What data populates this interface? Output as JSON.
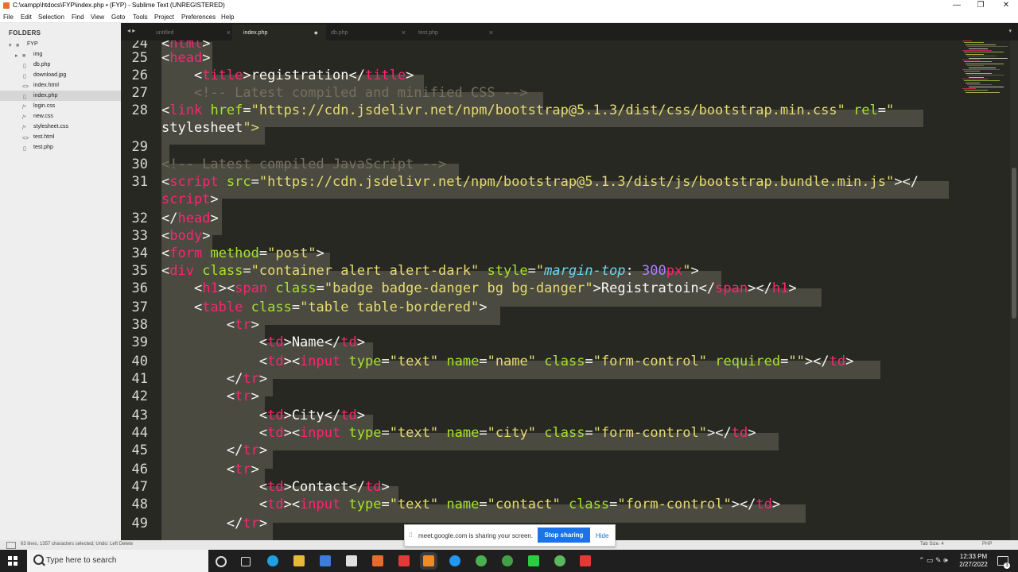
{
  "window": {
    "title": "C:\\xampp\\htdocs\\FYP\\index.php • (FYP) - Sublime Text (UNREGISTERED)",
    "minimize": "—",
    "maximize": "❐",
    "close": "✕"
  },
  "menu": [
    "File",
    "Edit",
    "Selection",
    "Find",
    "View",
    "Goto",
    "Tools",
    "Project",
    "Preferences",
    "Help"
  ],
  "sidebar": {
    "header": "FOLDERS",
    "root": "FYP",
    "items": [
      {
        "label": "img",
        "icon": "folder-icon"
      },
      {
        "label": "db.php",
        "icon": "file-icon"
      },
      {
        "label": "download.jpg",
        "icon": "file-icon"
      },
      {
        "label": "index.html",
        "icon": "code-file-icon"
      },
      {
        "label": "index.php",
        "icon": "file-icon",
        "selected": true
      },
      {
        "label": "login.css",
        "icon": "css-file-icon"
      },
      {
        "label": "new.css",
        "icon": "css-file-icon"
      },
      {
        "label": "stylesheet.css",
        "icon": "css-file-icon"
      },
      {
        "label": "test.html",
        "icon": "code-file-icon"
      },
      {
        "label": "test.php",
        "icon": "file-icon"
      }
    ]
  },
  "tabs": [
    {
      "label": "untitled",
      "close": "×"
    },
    {
      "label": "index.php",
      "close": "●",
      "active": true
    },
    {
      "label": "db.php",
      "close": "×"
    },
    {
      "label": "test.php",
      "close": "×"
    }
  ],
  "tabbar": {
    "nav": "◂ ▸",
    "dropdown": "▾"
  },
  "editor": {
    "line_numbers": [
      "24",
      "25",
      "26",
      "27",
      "28",
      "",
      "29",
      "30",
      "31",
      "",
      "32",
      "33",
      "34",
      "35",
      "36",
      "37",
      "38",
      "39",
      "40",
      "41",
      "42",
      "43",
      "44",
      "45",
      "46",
      "47",
      "48",
      "49"
    ],
    "lines": [
      "<html>",
      "<head>",
      "    <title>registration</title>",
      "    <!-- Latest compiled and minified CSS -->",
      "<link href=\"https://cdn.jsdelivr.net/npm/bootstrap@5.1.3/dist/css/bootstrap.min.css\" rel=\"",
      "stylesheet\">",
      "",
      "<!-- Latest compiled JavaScript -->",
      "<script src=\"https://cdn.jsdelivr.net/npm/bootstrap@5.1.3/dist/js/bootstrap.bundle.min.js\"></",
      "script>",
      "</head>",
      "<body>",
      "<form method=\"post\">",
      "<div class=\"container alert alert-dark\" style=\"margin-top: 300px\">",
      "    <h1><span class=\"badge badge-danger bg bg-danger\">Registratoin</span></h1>",
      "    <table class=\"table table-bordered\">",
      "        <tr>",
      "            <td>Name</td>",
      "            <td><input type=\"text\" name=\"name\" class=\"form-control\" required=\"\"></td>",
      "        </tr>",
      "        <tr>",
      "            <td>City</td>",
      "            <td><input type=\"text\" name=\"city\" class=\"form-control\"></td>",
      "        </tr>",
      "        <tr>",
      "            <td>Contact</td>",
      "            <td><input type=\"text\" name=\"contact\" class=\"form-control\"></td>",
      "        </tr>"
    ]
  },
  "status": {
    "left": "63 lines, 1357 characters selected; Undo: Left Delete",
    "tab_size": "Tab Size: 4",
    "syntax": "PHP"
  },
  "share_bar": {
    "message": "meet.google.com is sharing your screen.",
    "stop": "Stop sharing",
    "hide": "Hide"
  },
  "taskbar": {
    "search_placeholder": "Type here to search",
    "time": "12:33 PM",
    "date": "2/27/2022",
    "notifications": "3"
  },
  "colors": {
    "editor_bg": "#272822",
    "tag": "#f92672",
    "attr": "#a6e22e",
    "string": "#e6db74",
    "comment": "#75715e",
    "selection": "#4a4a40",
    "stop_sharing": "#1a73e8"
  }
}
